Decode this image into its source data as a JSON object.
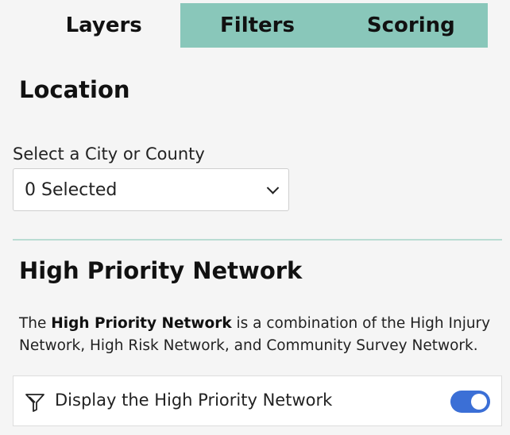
{
  "tabs": [
    {
      "label": "Layers",
      "active": true
    },
    {
      "label": "Filters",
      "active": false
    },
    {
      "label": "Scoring",
      "active": false
    }
  ],
  "location": {
    "title": "Location",
    "field_label": "Select a City or County",
    "select_value": "0 Selected",
    "select_icon": "chevron-down-icon"
  },
  "hpn": {
    "title": "High Priority Network",
    "description_prefix": "The ",
    "description_bold": "High Priority Network",
    "description_suffix": " is a combination of the High Injury Network, High Risk Network, and Community Survey Network.",
    "toggle_label": "Display the High Priority Network",
    "toggle_icon": "filter-icon",
    "toggle_on": true
  },
  "colors": {
    "tab_inactive": "#89c7ba",
    "toggle_on": "#3b6fd6",
    "divider": "#b9dcd3"
  }
}
